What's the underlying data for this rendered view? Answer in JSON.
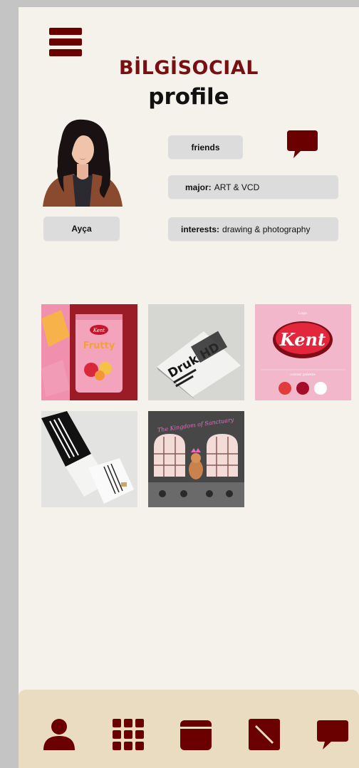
{
  "header": {
    "menu_icon": "hamburger-menu-icon",
    "brand": "BİLGİSOCIAL",
    "title": "profile"
  },
  "profile": {
    "name": "Ayça",
    "friends_label": "friends",
    "chat_icon": "chat-bubble-icon",
    "major_label": "major:",
    "major_value": "ART & VCD",
    "interests_label": "interests:",
    "interests_value": "drawing & photography"
  },
  "gallery": {
    "items": [
      {
        "kind": "candy-packaging",
        "brand_text": "Kent",
        "product_text": "Frutty"
      },
      {
        "kind": "typography-poster",
        "text": "Druk HD"
      },
      {
        "kind": "logo-sheet",
        "top_label": "Logo",
        "logo_text": "Kent",
        "palette_label": "colour palette",
        "palette": [
          "#e23b3b",
          "#a50d2a",
          "#ffffff"
        ]
      },
      {
        "kind": "brochure-mockup"
      },
      {
        "kind": "book-cover",
        "title": "The Kingdom of Sanctuary"
      }
    ]
  },
  "bottom_nav": [
    {
      "icon": "profile-icon"
    },
    {
      "icon": "grid-icon"
    },
    {
      "icon": "calendar-icon"
    },
    {
      "icon": "edit-icon"
    },
    {
      "icon": "chat-icon"
    }
  ],
  "colors": {
    "accent": "#6b0000",
    "background": "#f5f2eb",
    "nav_bar": "#e9dcc0",
    "pill": "#dcdcdc"
  }
}
